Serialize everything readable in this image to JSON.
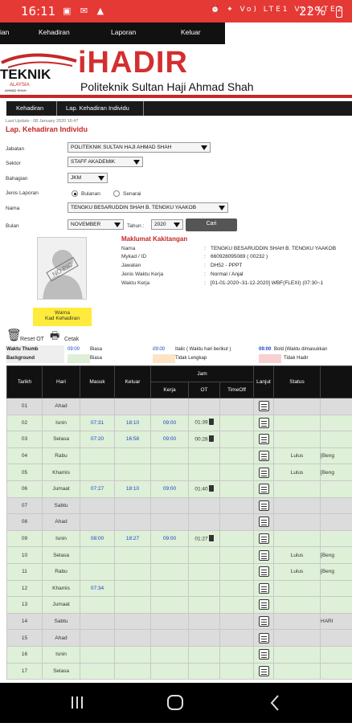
{
  "status": {
    "time": "16:11",
    "battery": "22%",
    "icons": "▣ ✉ ▲",
    "right_icons": "⏰ ✦ Vo) LTE1 Vo) LTE2"
  },
  "menu": [
    "ian",
    "Kehadiran",
    "Laporan",
    "Keluar"
  ],
  "header": {
    "app": "iHADIR",
    "org": "Politeknik Sultan Haji Ahmad Shah",
    "logo_text": "TEKNIK",
    "logo_sub": "ALAYSIA",
    "logo_sub2": "AHMAD SHAH"
  },
  "breadcrumb": [
    "Kehadiran",
    "Lap. Kehadiran Individu"
  ],
  "last_update": "Last Update : 08 January 2020 16:47",
  "page_title": "Lap. Kehadiran Individu",
  "form": {
    "jabatan_label": "Jabatan",
    "jabatan": "POLITEKNIK SULTAN HAJI AHMAD SHAH",
    "sektor_label": "Sektor",
    "sektor": "STAFF AKADEMIK",
    "bahagian_label": "Bahagian",
    "bahagian": "JKM",
    "jenis_label": "Jenis Laporan",
    "opt_bulanan": "Bulanan",
    "opt_senarai": "Senarai",
    "nama_label": "Nama",
    "nama": "TENGKU BESARUDDIN SHAH B. TENGKU YAAKOB",
    "bulan_label": "Bulan",
    "bulan": "NOVEMBER",
    "tahun_label": "Tahun :",
    "tahun": "2020",
    "cari": "Cari"
  },
  "photo_text": "NO PIC",
  "maklumat": {
    "title": "Maklumat Kakitangan",
    "rows": [
      {
        "label": "Nama",
        "value": "TENGKU BESARUDDIN SHAH B. TENGKU YAAKOB"
      },
      {
        "label": "Mykad / ID",
        "value": "660928095089 ( 00232 )"
      },
      {
        "label": "Jawatan",
        "value": "DH52 - PPPT"
      },
      {
        "label": "Jenis Waktu Kerja",
        "value": "Normal / Anjal"
      },
      {
        "label": "Waktu Kerja",
        "value": "[01-01-2020~31-12-2020] WBF(FLEXI) (07:30~1"
      }
    ]
  },
  "kad": {
    "line1": "Warna",
    "line2": "Kad Kehadiran"
  },
  "tools": {
    "reset": "Reset OT",
    "cetak": "Cetak"
  },
  "legend": {
    "waktu_label": "Waktu Thumb",
    "bg_label": "Background",
    "t1": "09:00",
    "d1": "Biasa",
    "t2": "09:00",
    "d2": "Italic ( Waktu hari berikut )",
    "t3": "09:00",
    "d3": "Bold (Waktu dimasukkan",
    "b1": "Biasa",
    "b2": "Tidak Lengkap",
    "b3": "Tidak Hadir"
  },
  "table": {
    "headers": {
      "tarikh": "Tarikh",
      "hari": "Hari",
      "masuk": "Masuk",
      "keluar": "Keluar",
      "jam": "Jam",
      "kerja": "Kerja",
      "ot": "OT",
      "timeoff": "TimeOff",
      "lanjut": "Lanjut",
      "status": "Status"
    },
    "rows": [
      {
        "tarikh": "01",
        "hari": "Ahad",
        "masuk": "",
        "keluar": "",
        "kerja": "",
        "ot": "",
        "status": "",
        "extra": "",
        "cls": "gray"
      },
      {
        "tarikh": "02",
        "hari": "Isnin",
        "masuk": "07:31",
        "keluar": "18:10",
        "kerja": "09:00",
        "ot": "01:39",
        "status": "",
        "extra": "",
        "cls": "green"
      },
      {
        "tarikh": "03",
        "hari": "Selasa",
        "masuk": "07:20",
        "keluar": "16:58",
        "kerja": "09:00",
        "ot": "00:28",
        "status": "",
        "extra": "",
        "cls": "green"
      },
      {
        "tarikh": "04",
        "hari": "Rabu",
        "masuk": "",
        "keluar": "",
        "kerja": "",
        "ot": "",
        "status": "Lulus",
        "extra": "[Beng",
        "cls": "green"
      },
      {
        "tarikh": "05",
        "hari": "Khamis",
        "masuk": "",
        "keluar": "",
        "kerja": "",
        "ot": "",
        "status": "Lulus",
        "extra": "[Beng",
        "cls": "green"
      },
      {
        "tarikh": "06",
        "hari": "Jumaat",
        "masuk": "07:27",
        "keluar": "18:10",
        "kerja": "09:00",
        "ot": "01:40",
        "status": "",
        "extra": "",
        "cls": "green"
      },
      {
        "tarikh": "07",
        "hari": "Sabtu",
        "masuk": "",
        "keluar": "",
        "kerja": "",
        "ot": "",
        "status": "",
        "extra": "",
        "cls": "gray"
      },
      {
        "tarikh": "08",
        "hari": "Ahad",
        "masuk": "",
        "keluar": "",
        "kerja": "",
        "ot": "",
        "status": "",
        "extra": "",
        "cls": "gray"
      },
      {
        "tarikh": "09",
        "hari": "Isnin",
        "masuk": "08:00",
        "keluar": "18:27",
        "kerja": "09:00",
        "ot": "01:27",
        "status": "",
        "extra": "",
        "cls": "green"
      },
      {
        "tarikh": "10",
        "hari": "Selasa",
        "masuk": "",
        "keluar": "",
        "kerja": "",
        "ot": "",
        "status": "Lulus",
        "extra": "[Beng",
        "cls": "green"
      },
      {
        "tarikh": "11",
        "hari": "Rabu",
        "masuk": "",
        "keluar": "",
        "kerja": "",
        "ot": "",
        "status": "Lulus",
        "extra": "[Beng",
        "cls": "green"
      },
      {
        "tarikh": "12",
        "hari": "Khamis",
        "masuk": "07:34",
        "keluar": "",
        "kerja": "",
        "ot": "",
        "status": "",
        "extra": "",
        "cls": "green"
      },
      {
        "tarikh": "13",
        "hari": "Jumaat",
        "masuk": "",
        "keluar": "",
        "kerja": "",
        "ot": "",
        "status": "",
        "extra": "",
        "cls": "green"
      },
      {
        "tarikh": "14",
        "hari": "Sabtu",
        "masuk": "",
        "keluar": "",
        "kerja": "",
        "ot": "",
        "status": "",
        "extra": "HARI",
        "cls": "gray"
      },
      {
        "tarikh": "15",
        "hari": "Ahad",
        "masuk": "",
        "keluar": "",
        "kerja": "",
        "ot": "",
        "status": "",
        "extra": "",
        "cls": "gray"
      },
      {
        "tarikh": "16",
        "hari": "Isnin",
        "masuk": "",
        "keluar": "",
        "kerja": "",
        "ot": "",
        "status": "",
        "extra": "",
        "cls": "green"
      },
      {
        "tarikh": "17",
        "hari": "Selasa",
        "masuk": "",
        "keluar": "",
        "kerja": "",
        "ot": "",
        "status": "",
        "extra": "",
        "cls": "green"
      }
    ]
  },
  "colors": {
    "status_bar": "#e53935",
    "brand_red": "#c62828",
    "row_green": "#dff0d8",
    "row_gray": "#dcdcdc",
    "time_blue": "#1a44c8"
  }
}
